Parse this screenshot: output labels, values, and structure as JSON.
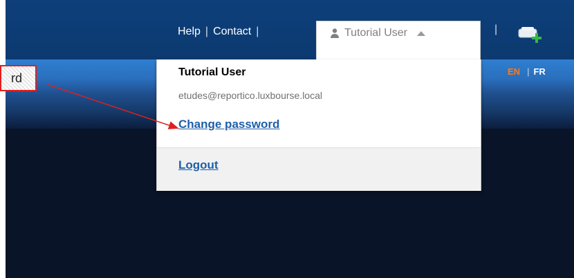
{
  "topnav": {
    "help": "Help",
    "contact": "Contact",
    "separator": "|"
  },
  "user_menu": {
    "tab_label": "Tutorial User",
    "name": "Tutorial User",
    "email": "etudes@reportico.luxbourse.local",
    "change_password": "Change password",
    "logout": "Logout"
  },
  "language": {
    "en": "EN",
    "sep": "|",
    "fr": "FR"
  },
  "annotation": {
    "callout_text": "rd"
  },
  "icons": [
    "person-icon",
    "caret-up-icon",
    "cart-add-icon"
  ],
  "colors": {
    "topbar": "#0e3f7a",
    "link": "#1f5ea8",
    "lang_active": "#ff7a1a",
    "annotation_red": "#e02020"
  }
}
